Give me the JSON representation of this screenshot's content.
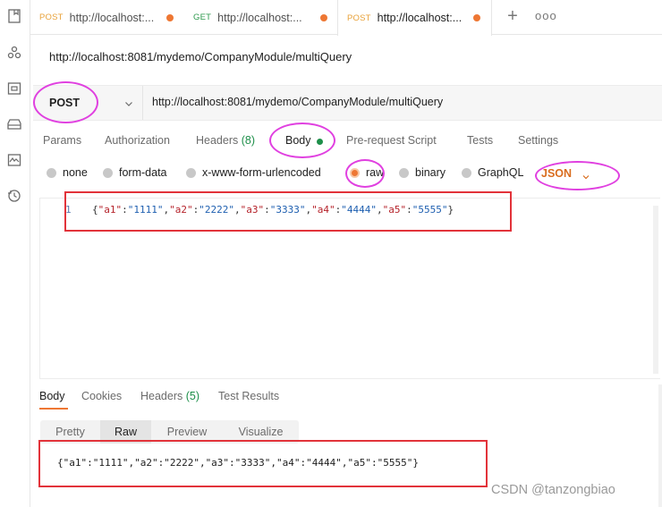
{
  "rail": {
    "icons": [
      "collections-icon",
      "apis-icon",
      "environments-icon",
      "mock-servers-icon",
      "monitors-icon",
      "history-icon"
    ]
  },
  "tabs": [
    {
      "method": "POST",
      "url": "http://localhost:...",
      "unsaved": true,
      "active": false
    },
    {
      "method": "GET",
      "url": "http://localhost:...",
      "unsaved": true,
      "active": false
    },
    {
      "method": "POST",
      "url": "http://localhost:...",
      "unsaved": true,
      "active": true
    }
  ],
  "tab_actions": {
    "new_tab": "+",
    "more": "ooo"
  },
  "request": {
    "name": "http://localhost:8081/mydemo/CompanyModule/multiQuery",
    "method": "POST",
    "url": "http://localhost:8081/mydemo/CompanyModule/multiQuery"
  },
  "request_tabs": {
    "params": "Params",
    "authorization": "Authorization",
    "headers": "Headers",
    "headers_count": "(8)",
    "body": "Body",
    "pre_request": "Pre-request Script",
    "tests": "Tests",
    "settings": "Settings"
  },
  "body_modes": {
    "none": "none",
    "form_data": "form-data",
    "urlencoded": "x-www-form-urlencoded",
    "raw": "raw",
    "binary": "binary",
    "graphql": "GraphQL",
    "selected": "raw",
    "format": "JSON"
  },
  "editor": {
    "line_number": "1",
    "pairs": [
      {
        "key": "\"a1\"",
        "value": "\"1111\""
      },
      {
        "key": "\"a2\"",
        "value": "\"2222\""
      },
      {
        "key": "\"a3\"",
        "value": "\"3333\""
      },
      {
        "key": "\"a4\"",
        "value": "\"4444\""
      },
      {
        "key": "\"a5\"",
        "value": "\"5555\""
      }
    ]
  },
  "response_tabs": {
    "body": "Body",
    "cookies": "Cookies",
    "headers": "Headers",
    "headers_count": "(5)",
    "test_results": "Test Results"
  },
  "response_views": {
    "pretty": "Pretty",
    "raw": "Raw",
    "preview": "Preview",
    "visualize": "Visualize",
    "selected": "Raw"
  },
  "response_body": "{\"a1\":\"1111\",\"a2\":\"2222\",\"a3\":\"3333\",\"a4\":\"4444\",\"a5\":\"5555\"}",
  "watermark": "CSDN @tanzongbiao",
  "colors": {
    "accent": "#ee7733",
    "post": "#e8a23a",
    "get": "#2e9a4e",
    "annotation_ring": "#e040e0",
    "annotation_box": "#e2333a",
    "json_key": "#b5222a",
    "json_value": "#1e5fb0"
  }
}
